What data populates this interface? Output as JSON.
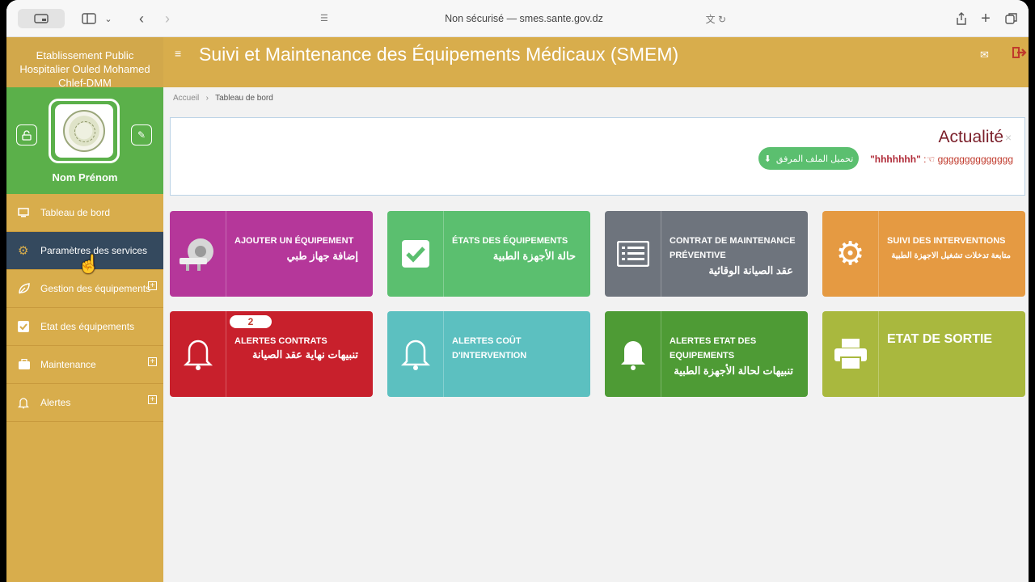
{
  "browser": {
    "url": "Non sécurisé — smes.sante.gov.dz"
  },
  "sidebar": {
    "org": "Etablissement Public Hospitalier Ouled Mohamed Chlef-DMM",
    "profile_name": "Nom Prénom",
    "items": [
      {
        "label": "Tableau de bord",
        "icon": "monitor-icon"
      },
      {
        "label": "Paramètres des services",
        "icon": "gear-icon"
      },
      {
        "label": "Gestion des équipements",
        "icon": "leaf-icon"
      },
      {
        "label": "Etat des équipements",
        "icon": "checkbox-icon"
      },
      {
        "label": "Maintenance",
        "icon": "briefcase-icon"
      },
      {
        "label": "Alertes",
        "icon": "bell-icon"
      }
    ]
  },
  "header": {
    "title": "Suivi et Maintenance des Équipements Médicaux (SMEM)"
  },
  "breadcrumb": {
    "home": "Accueil",
    "current": "Tableau de bord"
  },
  "news": {
    "title": "Actualité",
    "quoted": "\"hhhhhhh\"",
    "body": "gggggggggggggg",
    "download_label": "تحميل الملف المرفق"
  },
  "tiles": [
    {
      "title": "Ajouter un équipement",
      "arabic": "إضافة جهاز طبي",
      "color": "#b5379a",
      "icon": "scanner-icon"
    },
    {
      "title": "États des équipements",
      "arabic": "حالة الأجهزة الطبية",
      "color": "#5bbf6f",
      "icon": "checkbox-icon"
    },
    {
      "title": "Contrat de maintenance préventive",
      "arabic": "عقد الصيانة الوقائية",
      "color": "#6e747d",
      "icon": "list-icon"
    },
    {
      "title": "Suivi des interventions",
      "arabic": "متابعة تدخلات تشغيل الاجهزة الطبية",
      "color": "#e59a42",
      "icon": "gear-icon"
    },
    {
      "title": "Alertes contrats",
      "arabic": "تنبيهات نهاية عقد الصيانة",
      "color": "#c8202c",
      "icon": "bell-icon",
      "badge": "2"
    },
    {
      "title": "Alertes coût d'intervention",
      "arabic": "",
      "color": "#5cc0c0",
      "icon": "bell-icon"
    },
    {
      "title": "Alertes etat des equipements",
      "arabic": "تنبيهات لحالة الأجهزة الطبية",
      "color": "#4e9b35",
      "icon": "bell-icon"
    },
    {
      "title": "ETAT DE SORTIE",
      "arabic": "",
      "color": "#a9b83e",
      "icon": "printer-icon"
    }
  ]
}
